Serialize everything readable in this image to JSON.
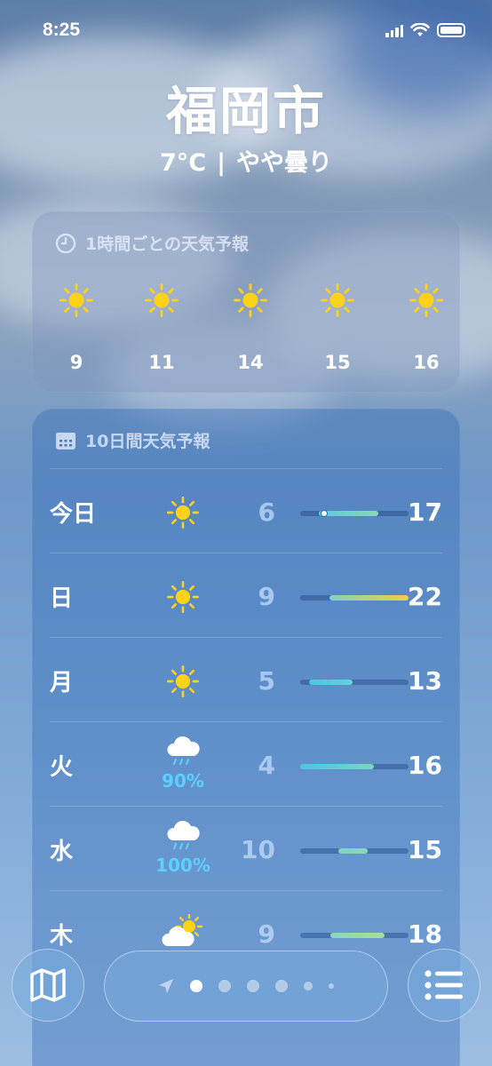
{
  "status": {
    "time": "8:25"
  },
  "header": {
    "city": "福岡市",
    "temp": "7°C",
    "separator": "|",
    "condition": "やや曇り"
  },
  "hourly": {
    "title": "1時間ごとの天気予報",
    "hours": [
      {
        "label": "9",
        "icon": "sun-icon"
      },
      {
        "label": "11",
        "icon": "sun-icon"
      },
      {
        "label": "14",
        "icon": "sun-icon"
      },
      {
        "label": "15",
        "icon": "sun-icon"
      },
      {
        "label": "16",
        "icon": "sun-icon"
      }
    ]
  },
  "daily": {
    "title": "10日間天気予報",
    "days": [
      {
        "day": "今日",
        "icon": "sun-icon",
        "pop": "",
        "low": "6",
        "high": "17",
        "range_start": 0.17,
        "range_end": 0.72,
        "colors": [
          "#5ac8e0",
          "#8ad8b8"
        ],
        "current_pos": 0.17
      },
      {
        "day": "日",
        "icon": "sun-icon",
        "pop": "",
        "low": "9",
        "high": "22",
        "range_start": 0.27,
        "range_end": 1.0,
        "colors": [
          "#7fd3c0",
          "#f0d040"
        ]
      },
      {
        "day": "月",
        "icon": "sun-icon",
        "pop": "",
        "low": "5",
        "high": "13",
        "range_start": 0.08,
        "range_end": 0.48,
        "colors": [
          "#4ac6e4",
          "#6ad0d8"
        ]
      },
      {
        "day": "火",
        "icon": "rain-cloud-icon",
        "pop": "90%",
        "low": "4",
        "high": "16",
        "range_start": 0.0,
        "range_end": 0.68,
        "colors": [
          "#4ac6e4",
          "#7ad4c8"
        ]
      },
      {
        "day": "水",
        "icon": "rain-cloud-icon",
        "pop": "100%",
        "low": "10",
        "high": "15",
        "range_start": 0.35,
        "range_end": 0.62,
        "colors": [
          "#7fd3c0",
          "#8ad8b8"
        ]
      },
      {
        "day": "木",
        "icon": "partly-cloudy-icon",
        "pop": "",
        "low": "9",
        "high": "18",
        "range_start": 0.28,
        "range_end": 0.78,
        "colors": [
          "#8ad8b8",
          "#a8dc9c"
        ]
      }
    ]
  },
  "nav": {
    "pages": 7,
    "active": 1
  }
}
